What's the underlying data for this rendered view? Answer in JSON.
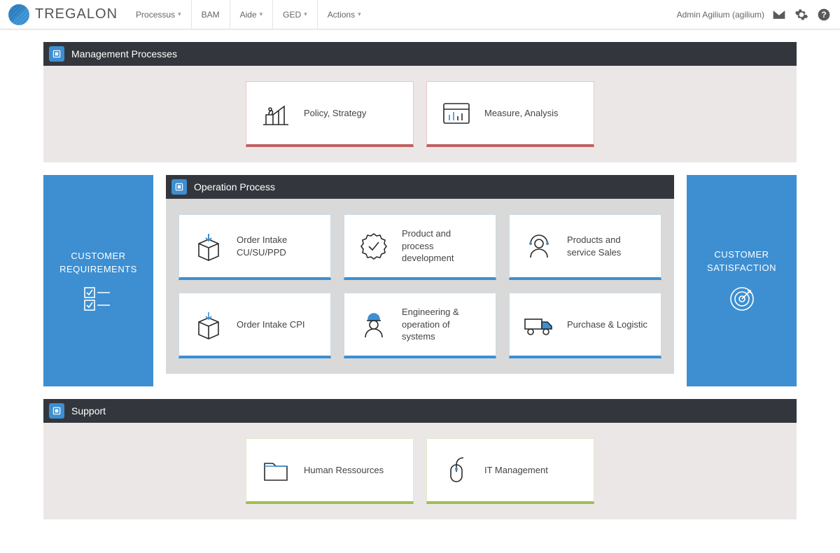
{
  "brand": "TREGALON",
  "nav": {
    "items": [
      "Processus",
      "BAM",
      "Aide",
      "GED",
      "Actions"
    ],
    "dropdown": [
      true,
      false,
      true,
      true,
      true
    ]
  },
  "user": "Admin Agilium (agilium)",
  "sections": {
    "management": {
      "title": "Management Processes",
      "cards": [
        {
          "label": "Policy, Strategy"
        },
        {
          "label": "Measure, Analysis"
        }
      ]
    },
    "operation": {
      "title": "Operation Process",
      "left": "CUSTOMER REQUIREMENTS",
      "right": "CUSTOMER SATISFACTION",
      "cards": [
        {
          "label": "Order Intake CU/SU/PPD"
        },
        {
          "label": "Product and process development"
        },
        {
          "label": "Products and service Sales"
        },
        {
          "label": "Order Intake CPI"
        },
        {
          "label": "Engineering & operation of systems"
        },
        {
          "label": "Purchase & Logistic"
        }
      ]
    },
    "support": {
      "title": "Support",
      "cards": [
        {
          "label": "Human Ressources"
        },
        {
          "label": "IT Management"
        }
      ]
    }
  }
}
